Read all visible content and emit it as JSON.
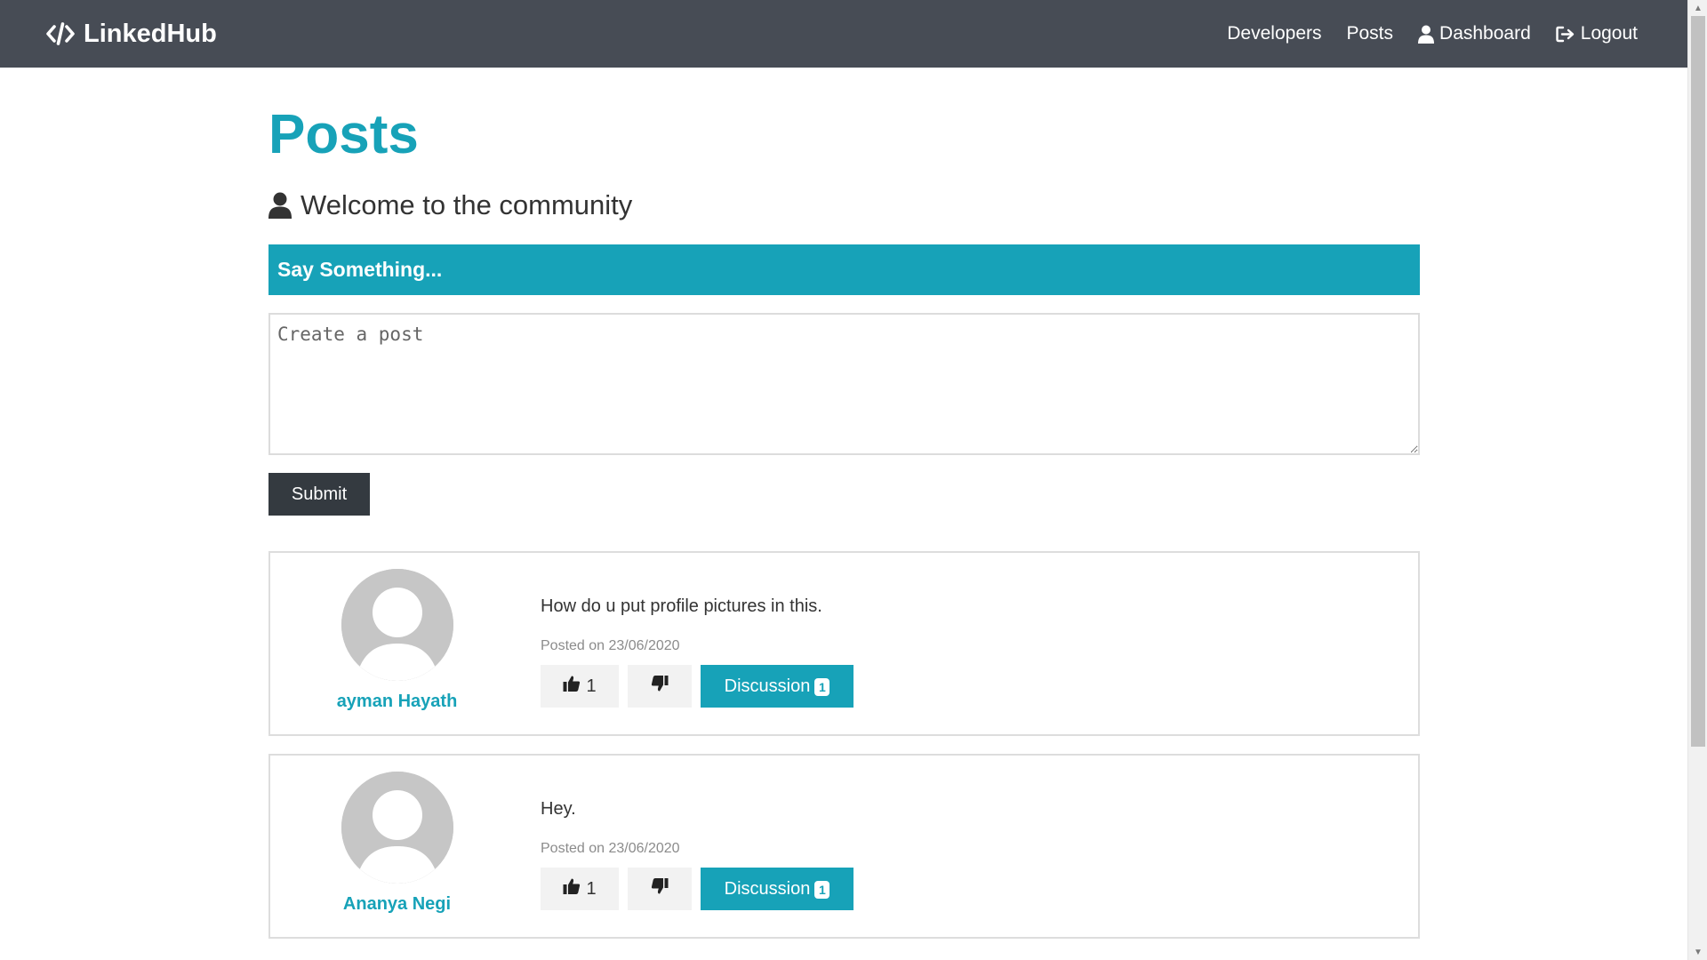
{
  "nav": {
    "brand": "LinkedHub",
    "links": [
      {
        "label": "Developers"
      },
      {
        "label": "Posts"
      },
      {
        "label": "Dashboard"
      },
      {
        "label": "Logout"
      }
    ]
  },
  "page": {
    "title": "Posts",
    "lead": "Welcome to the community"
  },
  "form": {
    "header": "Say Something...",
    "placeholder": "Create a post",
    "value": "",
    "submit_label": "Submit"
  },
  "posts": [
    {
      "author": "ayman Hayath",
      "text": "How do u put profile pictures in this.",
      "date": "Posted on 23/06/2020",
      "likes": "1",
      "discussion_label": "Discussion",
      "comments": "1"
    },
    {
      "author": "Ananya Negi",
      "text": "Hey.",
      "date": "Posted on 23/06/2020",
      "likes": "1",
      "discussion_label": "Discussion",
      "comments": "1"
    }
  ],
  "icons": {
    "brand": "code-icon",
    "dashboard": "user-icon",
    "logout": "sign-out-icon",
    "lead": "user-icon",
    "like": "thumbs-up-icon",
    "dislike": "thumbs-down-icon"
  },
  "colors": {
    "navbar": "#474c55",
    "accent": "#17a2b8",
    "dark_button": "#343a40",
    "light_button": "#f2f2f2",
    "avatar": "#c6c6c6"
  }
}
